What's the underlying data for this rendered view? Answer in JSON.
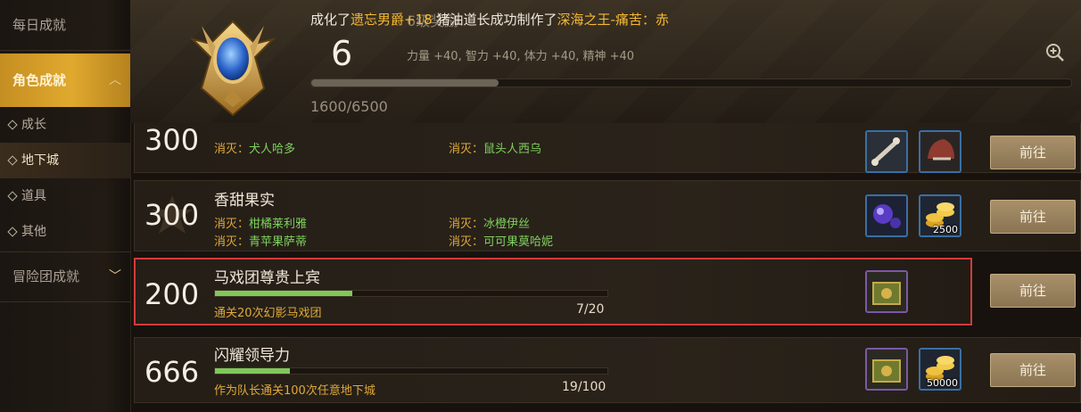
{
  "sidebar": {
    "daily": "每日成就",
    "character": "角色成就",
    "sub_items": [
      {
        "label": "成长"
      },
      {
        "label": "地下城"
      },
      {
        "label": "道具"
      },
      {
        "label": "其他"
      }
    ],
    "adventure": "冒险团成就"
  },
  "header": {
    "ticker_prefix": "成化了",
    "ticker_gold1": "遗忘男爵+18",
    "ticker_mid": "   猪油道长成功制作了",
    "ticker_gold2": "深海之王-痛苦：赤",
    "reward_title": "6级奖励",
    "level": "6",
    "stats": "力量 +40, 智力 +40, 体力 +40, 精神 +40",
    "progress": "1600/6500",
    "progress_fraction": 0.246
  },
  "achievements": [
    {
      "points": "300",
      "cond_label": "消灭：",
      "conds": [
        "犬人哈多",
        "鼠头人西乌"
      ],
      "button": "前往"
    },
    {
      "points": "300",
      "title": "香甜果实",
      "cond_label": "消灭：",
      "conds": [
        "柑橘莱利雅",
        "冰橙伊丝",
        "青苹果萨蒂",
        "可可果莫哈妮"
      ],
      "reward_count": "2500",
      "button": "前往"
    },
    {
      "points": "200",
      "title": "马戏团尊贵上宾",
      "task": "通关20次幻影马戏团",
      "count": "7/20",
      "progress_fraction": 0.35,
      "button": "前往"
    },
    {
      "points": "666",
      "title": "闪耀领导力",
      "task": "作为队长通关100次任意地下城",
      "count": "19/100",
      "progress_fraction": 0.19,
      "reward_count": "50000",
      "button": "前往"
    }
  ],
  "colors": {
    "gold": "#e0a93a",
    "green": "#7fd05e",
    "accent": "#e0a92e",
    "highlight": "#d43a3a"
  }
}
